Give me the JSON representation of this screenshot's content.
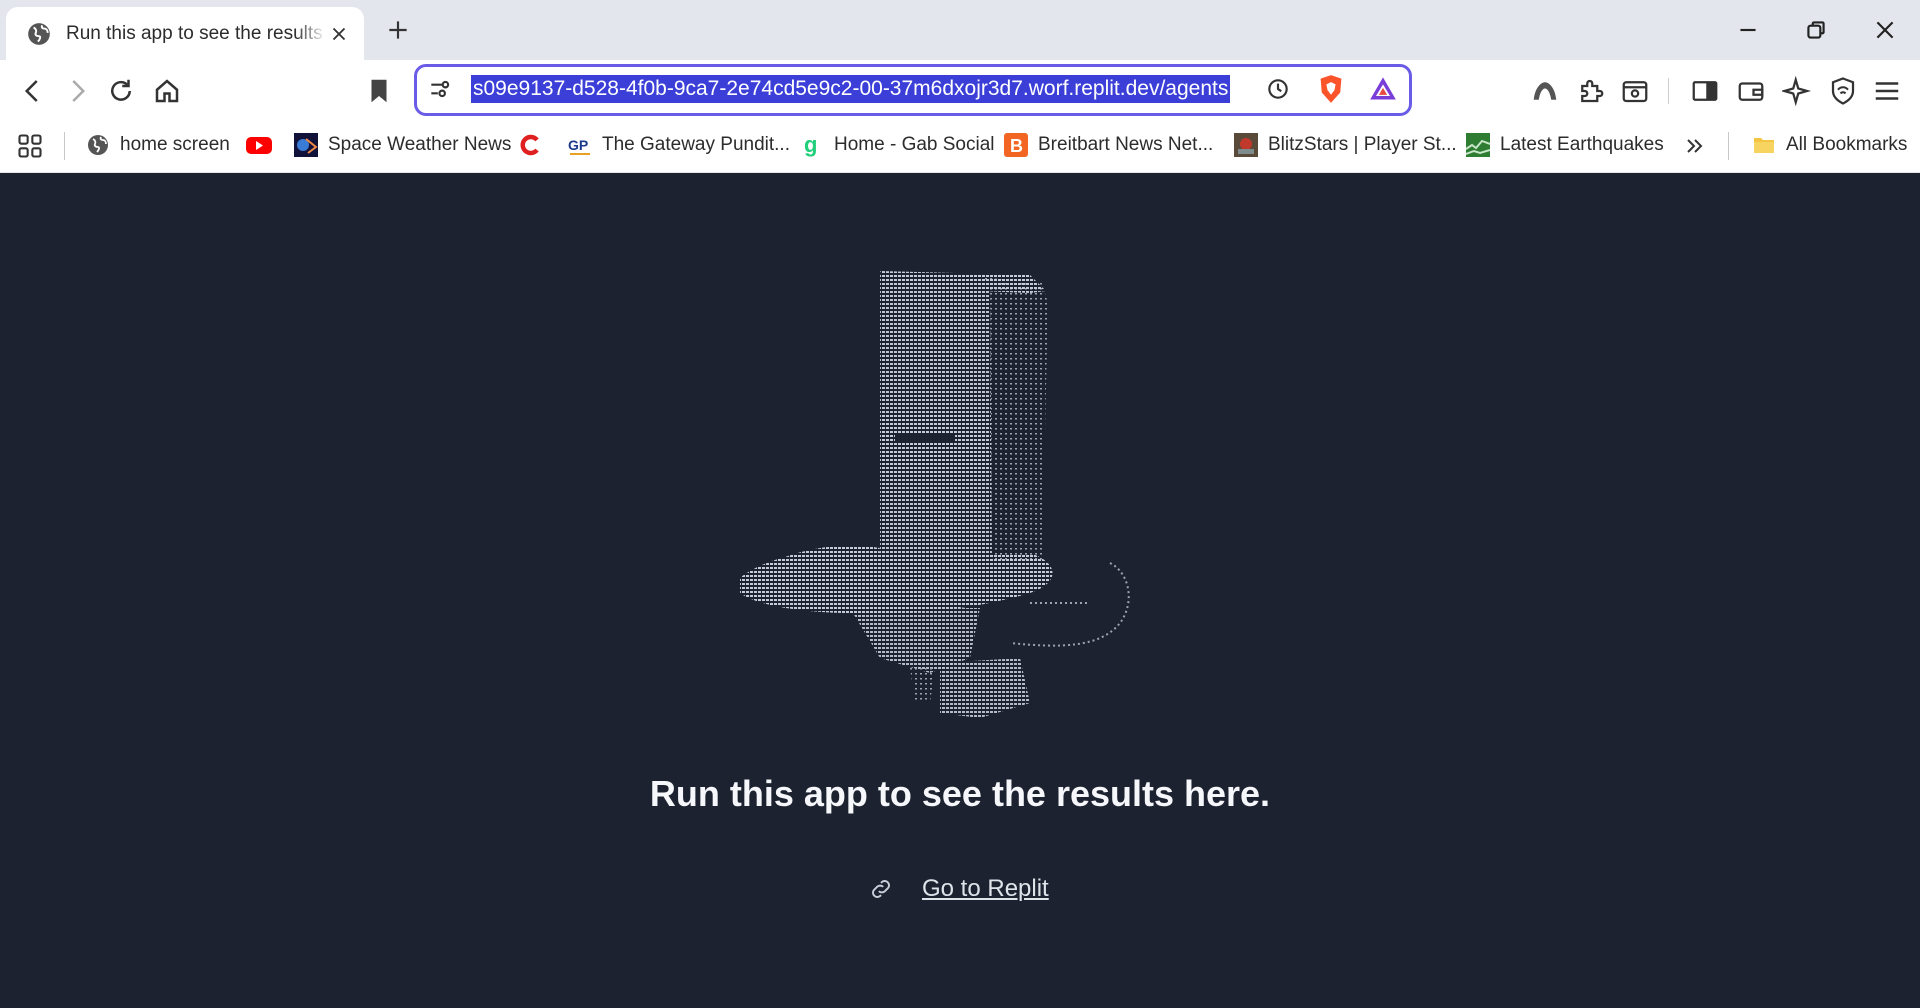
{
  "browser": {
    "tab": {
      "title": "Run this app to see the results here.",
      "favicon": "globe-icon"
    },
    "new_tab_icon": "plus-icon",
    "window_controls": [
      "minimize-icon",
      "restore-icon",
      "close-icon"
    ],
    "address_bar": {
      "url": "s09e9137-d528-4f0b-9ca7-2e74cd5e9c2-00-37m6dxojr3d7.worf.replit.dev/agents",
      "selected": true
    },
    "bookmarks": [
      {
        "label": "home screen",
        "icon": "globe-icon"
      },
      {
        "label": "",
        "icon": "youtube-icon"
      },
      {
        "label": "Space Weather News",
        "icon": "space-weather-icon"
      },
      {
        "label": "",
        "icon": "c-logo-icon"
      },
      {
        "label": "The Gateway Pundit...",
        "icon": "gp-icon"
      },
      {
        "label": "Home - Gab Social",
        "icon": "gab-icon"
      },
      {
        "label": "Breitbart News Net...",
        "icon": "breitbart-icon"
      },
      {
        "label": "BlitzStars | Player St...",
        "icon": "blitzstars-icon"
      },
      {
        "label": "Latest Earthquakes",
        "icon": "earthquake-icon"
      }
    ],
    "all_bookmarks": "All Bookmarks",
    "colors": {
      "accent": "#6b5ce7",
      "selection": "#3b3fd8",
      "page_bg": "#1d2230"
    }
  },
  "page": {
    "headline": "Run this app to see the results here.",
    "link_text": "Go to Replit",
    "link_icon": "link-icon",
    "illustration": "ascii-art-top-hat"
  }
}
